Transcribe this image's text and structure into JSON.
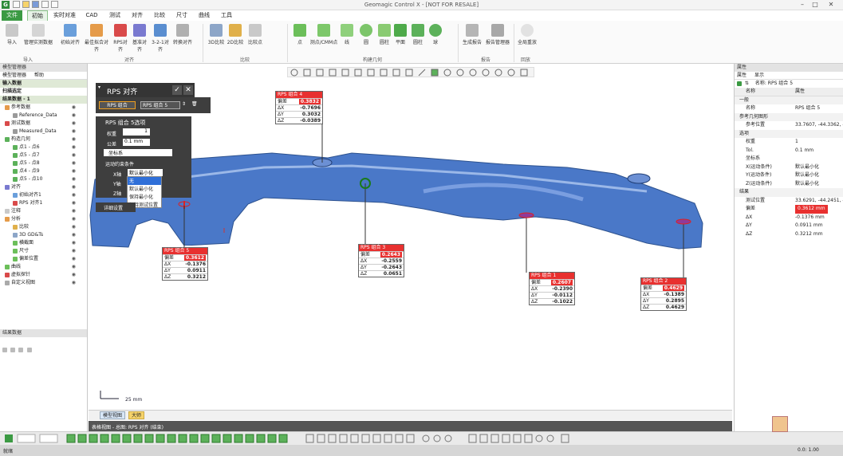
{
  "window": {
    "title": "Geomagic Control X - [NOT FOR RESALE]",
    "icon_letter": "G"
  },
  "tabs": [
    "文件",
    "初始",
    "实时对准",
    "CAD",
    "测试",
    "对齐",
    "比较",
    "尺寸",
    "曲线",
    "工具"
  ],
  "ribbon": {
    "buttons": [
      "导入",
      "管理实测数据",
      "初始对齐",
      "最佳拟合对齐",
      "RPS对齐",
      "基准对齐",
      "3-2-1对齐",
      "转换对齐",
      "3D比较",
      "2D比较",
      "比较点",
      "点",
      "测点/CMM点",
      "线",
      "圆",
      "圆柱",
      "平面",
      "圆柱",
      "球",
      "生成报告",
      "报告管理器",
      "全局重放"
    ],
    "groups": [
      "导入",
      "对齐",
      "比较",
      "构建几何",
      "报告",
      "回放"
    ]
  },
  "left": {
    "header": "模型管理器",
    "tabs": [
      "模型管理器",
      "帮助"
    ],
    "sections": [
      "输入数据",
      "扫描选定",
      "结果数据 - 1"
    ],
    "tree": [
      "参考数据",
      "Reference_Data",
      "测试数据",
      "Measured_Data",
      "构造几何",
      "点1 - 点6",
      "点5 - 点7",
      "点5 - 点8",
      "点4 - 点9",
      "点5 - 点10",
      "对齐",
      "初始对齐1",
      "RPS 对齐1",
      "注释",
      "分析",
      "比较",
      "3D GD&Ts",
      "横截面",
      "尺寸",
      "偏差位置",
      "曲线",
      "虚拟探针",
      "自定义视图"
    ],
    "bottom_header": "结果数据"
  },
  "dialog": {
    "title": "RPS 对齐",
    "combo_left": "RPS 组合",
    "combo_right": "RPS 组合 5",
    "sub_title": "RPS 组合 5选项",
    "weight_label": "权重",
    "weight_value": "1",
    "tol_label": "公差",
    "tol_value": "0.1 mm",
    "coord_label": "坐标系",
    "axis_section": "运动约束条件",
    "x_label": "X轴",
    "x_value": "默认最小化",
    "y_label": "Y轴",
    "z_label": "Z轴",
    "dropdown_options": [
      "无",
      "默认最小化",
      "保持最小化",
      "保持测试位置"
    ],
    "more": "详细设置"
  },
  "callouts": [
    {
      "title": "RPS 组合 4",
      "dev_label": "偏差",
      "dev": "0.3832",
      "rows": [
        [
          "ΔX",
          "-0.7696"
        ],
        [
          "ΔY",
          "0.3032"
        ],
        [
          "ΔZ",
          "-0.0389"
        ]
      ]
    },
    {
      "title": "RPS 组合 5",
      "dev_label": "偏差",
      "dev": "0.3612",
      "rows": [
        [
          "ΔX",
          "-0.1376"
        ],
        [
          "ΔY",
          "0.0911"
        ],
        [
          "ΔZ",
          "0.3212"
        ]
      ]
    },
    {
      "title": "RPS 组合 3",
      "dev_label": "偏差",
      "dev": "0.2643",
      "rows": [
        [
          "ΔX",
          "-0.2559"
        ],
        [
          "ΔY",
          "-0.2643"
        ],
        [
          "ΔZ",
          "0.0651"
        ]
      ]
    },
    {
      "title": "RPS 组合 1",
      "dev_label": "偏差",
      "dev": "0.2607",
      "rows": [
        [
          "ΔX",
          "-0.2390"
        ],
        [
          "ΔY",
          "-0.0112"
        ],
        [
          "ΔZ",
          "-0.1022"
        ]
      ]
    },
    {
      "title": "RPS 组合 2",
      "dev_label": "偏差",
      "dev": "0.4629",
      "rows": [
        [
          "ΔX",
          "-0.1389"
        ],
        [
          "ΔY",
          "0.2895"
        ],
        [
          "ΔZ",
          "0.4629"
        ]
      ]
    }
  ],
  "scale": "25 mm",
  "view_tabs": [
    "模型视图",
    "大师"
  ],
  "mini_bar": "表格视图 - 总图: RPS 对齐 (结束)",
  "right": {
    "header": "属性",
    "tabs": [
      "属性",
      "显示"
    ],
    "name_label": "名称: RPS 组合 5",
    "col_name": "名称",
    "col_value": "属性",
    "rows": [
      {
        "k": "一般",
        "v": "",
        "group": true
      },
      {
        "k": "名称",
        "v": "RPS 组合 5"
      },
      {
        "k": "参考几何图形",
        "v": "",
        "group": true
      },
      {
        "k": "参考位置",
        "v": "33.7607, -44.3362, -"
      },
      {
        "k": "选项",
        "v": "",
        "group": true
      },
      {
        "k": "权重",
        "v": "1"
      },
      {
        "k": "Tol.",
        "v": "0.1 mm"
      },
      {
        "k": "坐标系",
        "v": ""
      },
      {
        "k": "X(运动条件)",
        "v": "默认最小化"
      },
      {
        "k": "Y(运动条件)",
        "v": "默认最小化"
      },
      {
        "k": "Z(运动条件)",
        "v": "默认最小化"
      },
      {
        "k": "结果",
        "v": "",
        "group": true
      },
      {
        "k": "测试位置",
        "v": "33.6291, -44.2451, -"
      },
      {
        "k": "偏差",
        "v": "0.3612 mm",
        "dev": true
      },
      {
        "k": "ΔX",
        "v": "-0.1376 mm"
      },
      {
        "k": "ΔY",
        "v": "0.0911 mm"
      },
      {
        "k": "ΔZ",
        "v": "0.3212 mm"
      }
    ]
  },
  "status": {
    "left": "就绪",
    "right": "0.0: 1.00"
  },
  "colors": {
    "accent": "#3b9a43",
    "deviation": "#e8302f",
    "mesh": "#4a78c8",
    "dialog": "#3e3e3e"
  }
}
